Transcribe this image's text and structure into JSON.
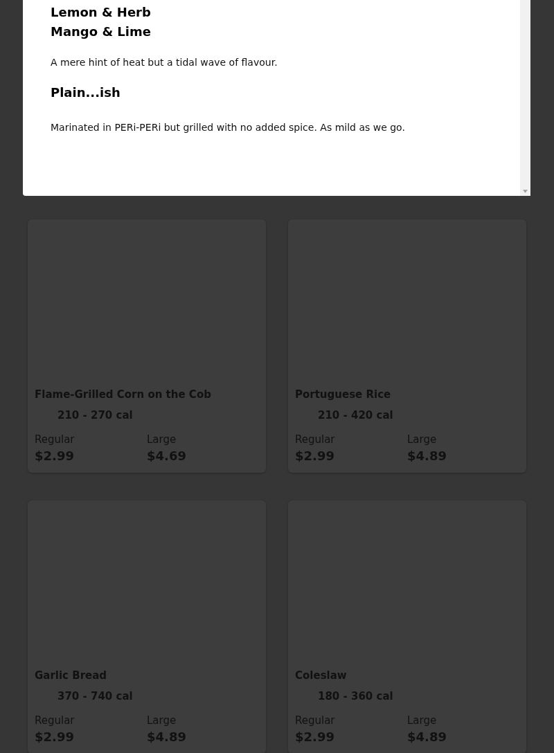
{
  "flavours": {
    "headings": [
      "Lemon & Herb",
      "Mango & Lime"
    ],
    "description": "A mere hint of heat but a tidal wave of flavour.",
    "next_heading": "Plain...ish",
    "next_description": "Marinated in PERi-PERi but grilled with no added spice. As mild as we go."
  },
  "items": [
    {
      "name": "Flame-Grilled Corn on the Cob",
      "calories": "210 - 270 cal",
      "prices": [
        {
          "size": "Regular",
          "price": "$2.99"
        },
        {
          "size": "Large",
          "price": "$4.69"
        }
      ]
    },
    {
      "name": "Portuguese Rice",
      "calories": "210 - 420 cal",
      "prices": [
        {
          "size": "Regular",
          "price": "$2.99"
        },
        {
          "size": "Large",
          "price": "$4.89"
        }
      ]
    },
    {
      "name": "Garlic Bread",
      "calories": "370 - 740 cal",
      "prices": [
        {
          "size": "Regular",
          "price": "$2.99"
        },
        {
          "size": "Large",
          "price": "$4.89"
        }
      ]
    },
    {
      "name": "Coleslaw",
      "calories": "180 - 360 cal",
      "prices": [
        {
          "size": "Regular",
          "price": "$2.99"
        },
        {
          "size": "Large",
          "price": "$4.89"
        }
      ]
    }
  ]
}
